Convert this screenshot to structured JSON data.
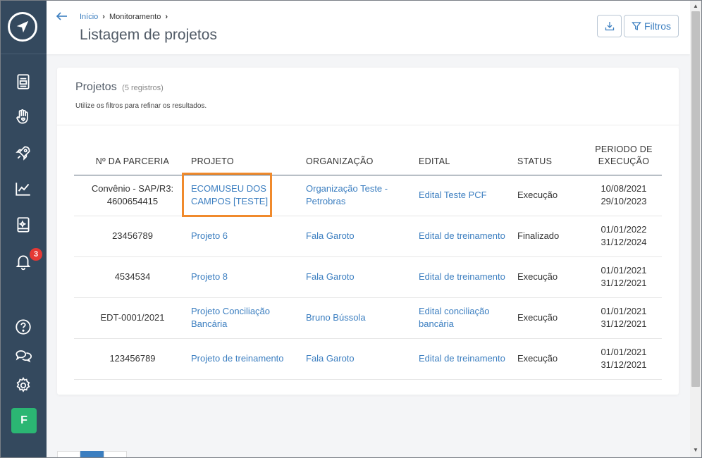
{
  "sidebar": {
    "items": [
      {
        "name": "document-icon"
      },
      {
        "name": "hand-heart-icon"
      },
      {
        "name": "rocket-icon"
      },
      {
        "name": "chart-line-icon"
      },
      {
        "name": "book-icon"
      },
      {
        "name": "bell-icon",
        "badge": "3"
      }
    ],
    "bottom": [
      {
        "name": "help-icon"
      },
      {
        "name": "chat-icon"
      },
      {
        "name": "gear-icon"
      }
    ],
    "avatar_letter": "F"
  },
  "header": {
    "breadcrumb": {
      "home": "Início",
      "current": "Monitoramento"
    },
    "title": "Listagem de projetos",
    "filter_label": "Filtros"
  },
  "card": {
    "title": "Projetos",
    "count": "(5 registros)",
    "subtitle": "Utilize os filtros para refinar os resultados."
  },
  "table": {
    "headers": [
      "Nº DA PARCERIA",
      "PROJETO",
      "ORGANIZAÇÃO",
      "EDITAL",
      "STATUS",
      "PERIODO DE EXECUÇÃO"
    ],
    "rows": [
      {
        "parceria": "Convênio - SAP/R3: 4600654415",
        "projeto": "ECOMUSEU DOS CAMPOS [TESTE]",
        "organizacao": "Organização Teste - Petrobras",
        "edital": "Edital Teste PCF",
        "status": "Execução",
        "inicio": "10/08/2021",
        "fim": "29/10/2023"
      },
      {
        "parceria": "23456789",
        "projeto": "Projeto 6",
        "organizacao": "Fala Garoto",
        "edital": "Edital de treinamento",
        "status": "Finalizado",
        "inicio": "01/01/2022",
        "fim": "31/12/2024"
      },
      {
        "parceria": "4534534",
        "projeto": "Projeto 8",
        "organizacao": "Fala Garoto",
        "edital": "Edital de treinamento",
        "status": "Execução",
        "inicio": "01/01/2021",
        "fim": "31/12/2021"
      },
      {
        "parceria": "EDT-0001/2021",
        "projeto": "Projeto Conciliação Bancária",
        "organizacao": "Bruno Bússola",
        "edital": "Edital conciliação bancária",
        "status": "Execução",
        "inicio": "01/01/2021",
        "fim": "31/12/2021"
      },
      {
        "parceria": "123456789",
        "projeto": "Projeto de treinamento",
        "organizacao": "Fala Garoto",
        "edital": "Edital de treinamento",
        "status": "Execução",
        "inicio": "01/01/2021",
        "fim": "31/12/2021"
      }
    ]
  },
  "colors": {
    "sidebar": "#34495e",
    "link": "#3b7ec0",
    "highlight": "#f08a2c",
    "badge": "#e53935",
    "avatar": "#2bb673"
  }
}
